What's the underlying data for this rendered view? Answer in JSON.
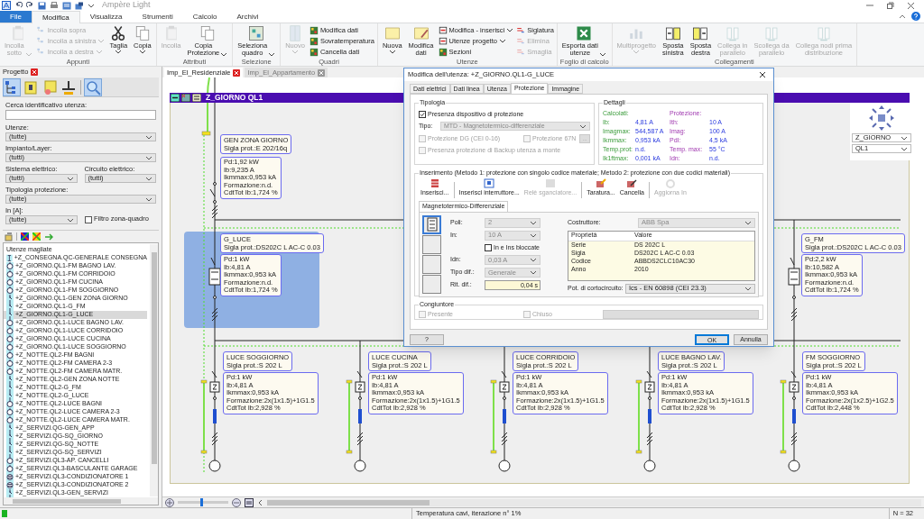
{
  "app": {
    "title": "Ampère Light"
  },
  "menu_tabs": [
    {
      "label": "File",
      "kind": "file",
      "selected": false
    },
    {
      "label": "Modifica",
      "kind": "tab",
      "selected": true
    },
    {
      "label": "Visualizza",
      "kind": "tab",
      "selected": false
    },
    {
      "label": "Strumenti",
      "kind": "tab",
      "selected": false
    },
    {
      "label": "Calcolo",
      "kind": "tab",
      "selected": false
    },
    {
      "label": "Archivi",
      "kind": "tab",
      "selected": false
    }
  ],
  "ribbon": [
    {
      "label": "Appunti",
      "items": [
        {
          "kind": "large",
          "label": "Incolla\nsotto",
          "disabled": true,
          "dropdown": true
        },
        {
          "kind": "stack",
          "buttons": [
            {
              "label": "Incolla sopra",
              "disabled": true,
              "dropdown": false
            },
            {
              "label": "Incolla a sinistra",
              "disabled": true,
              "dropdown": true
            },
            {
              "label": "Incolla a destra",
              "disabled": true,
              "dropdown": true
            }
          ]
        },
        {
          "kind": "large",
          "label": "Taglia",
          "disabled": false,
          "dropdown": true
        },
        {
          "kind": "large",
          "label": "Copia",
          "disabled": false,
          "dropdown": true
        }
      ]
    },
    {
      "label": "Attributi",
      "items": [
        {
          "kind": "large",
          "label": "Incolla",
          "disabled": true,
          "dropdown": false
        },
        {
          "kind": "large",
          "label": "Copia\nProtezione",
          "disabled": false,
          "dropdown": true
        }
      ]
    },
    {
      "label": "Selezione",
      "items": [
        {
          "kind": "large",
          "label": "Seleziona\nquadro",
          "disabled": false,
          "dropdown": true
        }
      ]
    },
    {
      "label": "Quadri",
      "items": [
        {
          "kind": "large",
          "label": "Nuovo",
          "disabled": true,
          "dropdown": true
        },
        {
          "kind": "stack",
          "buttons": [
            {
              "label": "Modifica dati",
              "disabled": false,
              "dropdown": false
            },
            {
              "label": "Sovratemperatura",
              "disabled": false,
              "dropdown": false
            },
            {
              "label": "Cancella dati",
              "disabled": false,
              "dropdown": false
            }
          ]
        }
      ]
    },
    {
      "label": "Utenze",
      "items": [
        {
          "kind": "large",
          "label": "Nuova",
          "disabled": false,
          "dropdown": true
        },
        {
          "kind": "large",
          "label": "Modifica\ndati",
          "disabled": false,
          "dropdown": false
        },
        {
          "kind": "stack",
          "buttons": [
            {
              "label": "Modifica - inserisci",
              "disabled": false,
              "dropdown": true
            },
            {
              "label": "Utenze progetto",
              "disabled": false,
              "dropdown": true
            },
            {
              "label": "Sezioni",
              "disabled": false,
              "dropdown": false
            }
          ]
        },
        {
          "kind": "stack",
          "buttons": [
            {
              "label": "Siglatura",
              "disabled": false,
              "dropdown": false
            },
            {
              "label": "Elimina",
              "disabled": true,
              "dropdown": false
            },
            {
              "label": "Smaglia",
              "disabled": true,
              "dropdown": false
            }
          ]
        }
      ]
    },
    {
      "label": "Foglio di calcolo",
      "items": [
        {
          "kind": "large",
          "label": "Esporta dati\nutenze",
          "disabled": false,
          "dropdown": true
        }
      ]
    },
    {
      "label": "Collegamenti",
      "items": [
        {
          "kind": "large",
          "label": "Multiprogetto",
          "disabled": true,
          "dropdown": true
        },
        {
          "kind": "large",
          "label": "Sposta\nsinistra",
          "disabled": false,
          "dropdown": false
        },
        {
          "kind": "large",
          "label": "Sposta\ndestra",
          "disabled": false,
          "dropdown": false
        },
        {
          "kind": "large",
          "label": "Collega in\nparallelo",
          "disabled": true,
          "dropdown": false
        },
        {
          "kind": "large",
          "label": "Scollega da\nparallelo",
          "disabled": true,
          "dropdown": false
        },
        {
          "kind": "large",
          "label": "Collega nodi prima\ndistribuzione",
          "disabled": true,
          "dropdown": false
        }
      ]
    }
  ],
  "project_panel": {
    "title": "Progetto",
    "toolbar": [
      {
        "selected": true
      },
      {
        "selected": false
      },
      {
        "selected": false
      },
      {
        "selected": false
      },
      {
        "selected": true
      }
    ],
    "search": {
      "label": "Cerca identificativo utenza:"
    },
    "filter_rows": [
      [
        {
          "label": "Utenze:",
          "value": "(tutte)"
        }
      ],
      [
        {
          "label": "Impianto/Layer:",
          "value": "(tutti)"
        }
      ],
      [
        {
          "label": "Sistema elettrico:",
          "value": "(tutti)"
        },
        {
          "label": "Circuito elettrico:",
          "value": "(tutti)"
        }
      ],
      [
        {
          "label": "Tipologia protezione:",
          "value": "(tutte)"
        }
      ],
      [
        {
          "label": "In [A]:",
          "value": "(tutte)"
        }
      ]
    ],
    "zone_filter": {
      "label": "Filtro zona-quadro",
      "checked": false
    },
    "list_title": "Utenze magliate",
    "items": [
      {
        "label": "+Z_CONSEGNA.QC-GENERALE CONSEGNA",
        "kind": "supply",
        "selected": false
      },
      {
        "label": "+Z_GIORNO.QL1-FM BAGNO LAV.",
        "kind": "load",
        "selected": false
      },
      {
        "label": "+Z_GIORNO.QL1-FM CORRIDOIO",
        "kind": "load",
        "selected": false
      },
      {
        "label": "+Z_GIORNO.QL1-FM CUCINA",
        "kind": "load",
        "selected": false
      },
      {
        "label": "+Z_GIORNO.QL1-FM SOGGIORNO",
        "kind": "load",
        "selected": false
      },
      {
        "label": "+Z_GIORNO.QL1-GEN ZONA GIORNO",
        "kind": "node",
        "selected": false
      },
      {
        "label": "+Z_GIORNO.QL1-G_FM",
        "kind": "node",
        "selected": false
      },
      {
        "label": "+Z_GIORNO.QL1-G_LUCE",
        "kind": "node",
        "selected": true
      },
      {
        "label": "+Z_GIORNO.QL1-LUCE BAGNO LAV.",
        "kind": "load",
        "selected": false
      },
      {
        "label": "+Z_GIORNO.QL1-LUCE CORRIDOIO",
        "kind": "load",
        "selected": false
      },
      {
        "label": "+Z_GIORNO.QL1-LUCE CUCINA",
        "kind": "load",
        "selected": false
      },
      {
        "label": "+Z_GIORNO.QL1-LUCE SOGGIORNO",
        "kind": "load",
        "selected": false
      },
      {
        "label": "+Z_NOTTE.QL2-FM BAGNI",
        "kind": "load",
        "selected": false
      },
      {
        "label": "+Z_NOTTE.QL2-FM CAMERA 2-3",
        "kind": "load",
        "selected": false
      },
      {
        "label": "+Z_NOTTE.QL2-FM CAMERA MATR.",
        "kind": "load",
        "selected": false
      },
      {
        "label": "+Z_NOTTE.QL2-GEN ZONA NOTTE",
        "kind": "node",
        "selected": false
      },
      {
        "label": "+Z_NOTTE.QL2-G_FM",
        "kind": "node",
        "selected": false
      },
      {
        "label": "+Z_NOTTE.QL2-G_LUCE",
        "kind": "node",
        "selected": false
      },
      {
        "label": "+Z_NOTTE.QL2-LUCE BAGNI",
        "kind": "load",
        "selected": false
      },
      {
        "label": "+Z_NOTTE.QL2-LUCE CAMERA 2-3",
        "kind": "load",
        "selected": false
      },
      {
        "label": "+Z_NOTTE.QL2-LUCE CAMERA MATR.",
        "kind": "load",
        "selected": false
      },
      {
        "label": "+Z_SERVIZI.QG-GEN_APP",
        "kind": "node",
        "selected": false
      },
      {
        "label": "+Z_SERVIZI.QG-SQ_GIORNO",
        "kind": "node",
        "selected": false
      },
      {
        "label": "+Z_SERVIZI.QG-SQ_NOTTE",
        "kind": "node",
        "selected": false
      },
      {
        "label": "+Z_SERVIZI.QG-SQ_SERVIZI",
        "kind": "node",
        "selected": false
      },
      {
        "label": "+Z_SERVIZI.QL3-AP. CANCELLI",
        "kind": "load",
        "selected": false
      },
      {
        "label": "+Z_SERVIZI.QL3-BASCULANTE GARAGE",
        "kind": "load",
        "selected": false
      },
      {
        "label": "+Z_SERVIZI.QL3-CONDIZIONATORE 1",
        "kind": "motor",
        "selected": false
      },
      {
        "label": "+Z_SERVIZI.QL3-CONDIZIONATORE 2",
        "kind": "motor",
        "selected": false
      },
      {
        "label": "+Z_SERVIZI.QL3-GEN_SERVIZI",
        "kind": "node",
        "selected": false
      }
    ]
  },
  "document_tabs": [
    {
      "label": "Imp_El_Residenziale",
      "selected": true
    },
    {
      "label": "Imp_El_Appartamento",
      "selected": false
    }
  ],
  "diagram": {
    "title": "Z_GIORNO QL1",
    "main_node": {
      "label": "GEN ZONA GIORNO",
      "sigla": "Sigla prot.:E 202/16q",
      "data": [
        "Pd:1,92 kW",
        "Ib:9,235 A",
        "Ikmmax:0,953 kA",
        "Formazione:n.d.",
        "CdtTot Ib:1,724 %"
      ]
    },
    "group_nodes": [
      {
        "label": "G_LUCE",
        "sigla": "Sigla prot.:DS202C L AC-C 0.03",
        "selected": true,
        "data": [
          "Pd:1 kW",
          "Ib:4,81 A",
          "Ikmmax:0,953 kA",
          "Formazione:n.d.",
          "CdtTot Ib:1,724 %"
        ]
      },
      {
        "label": "G_FM",
        "sigla": "Sigla prot.:DS202C L AC-C 0.03",
        "selected": false,
        "data": [
          "Pd:2,2 kW",
          "Ib:10,582 A",
          "Ikmmax:0,953 kA",
          "Formazione:n.d.",
          "CdtTot Ib:1,724 %"
        ]
      }
    ],
    "loads": [
      {
        "label": "LUCE SOGGIORNO",
        "sigla": "Sigla prot.:S 202 L",
        "data": [
          "Pd:1 kW",
          "Ib:4,81 A",
          "Ikmmax:0,953 kA",
          "Formazione:2x(1x1.5)+1G1.5",
          "CdtTot Ib:2,928 %"
        ]
      },
      {
        "label": "LUCE CUCINA",
        "sigla": "Sigla prot.:S 202 L",
        "data": [
          "Pd:1 kW",
          "Ib:4,81 A",
          "Ikmmax:0,953 kA",
          "Formazione:2x(1x1.5)+1G1.5",
          "CdtTot Ib:2,928 %"
        ]
      },
      {
        "label": "LUCE CORRIDOIO",
        "sigla": "Sigla prot.:S 202 L",
        "data": [
          "Pd:1 kW",
          "Ib:4,81 A",
          "Ikmmax:0,953 kA",
          "Formazione:2x(1x1.5)+1G1.5",
          "CdtTot Ib:2,928 %"
        ]
      },
      {
        "label": "LUCE BAGNO LAV.",
        "sigla": "Sigla prot.:S 202 L",
        "data": [
          "Pd:1 kW",
          "Ib:4,81 A",
          "Ikmmax:0,953 kA",
          "Formazione:2x(1x1.5)+1G1.5",
          "CdtTot Ib:2,928 %"
        ]
      },
      {
        "label": "FM SOGGIORNO",
        "sigla": "Sigla prot.:S 202 L",
        "data": [
          "Pd:1 kW",
          "Ib:4,81 A",
          "Ikmmax:0,953 kA",
          "Formazione:2x(1x2.5)+1G2.5",
          "CdtTot Ib:2,448 %"
        ]
      }
    ],
    "navigator": {
      "zone": "Z_GIORNO",
      "panel": "QL1"
    },
    "zoom": {
      "level": 0.45
    }
  },
  "dialog": {
    "title": "Modifica dell'utenza: +Z_GIORNO.QL1-G_LUCE",
    "tabs": [
      {
        "label": "Dati elettrici",
        "selected": false
      },
      {
        "label": "Dati linea",
        "selected": false
      },
      {
        "label": "Utenza",
        "selected": false
      },
      {
        "label": "Protezione",
        "selected": true
      },
      {
        "label": "Immagine",
        "selected": false
      }
    ],
    "tipologia": {
      "title": "Tipologia",
      "presence": {
        "label": "Presenza dispositivo di protezione",
        "checked": true,
        "disabled": false
      },
      "tipo_label": "Tipo:",
      "tipo_value": "MTD - Magnetotermico-differenziale",
      "dg": {
        "label": "Protezione DG (CEI 0-16)",
        "checked": false,
        "disabled": true
      },
      "p67n": {
        "label": "Protezione 67N",
        "checked": false,
        "disabled": true
      },
      "more_button": "...",
      "backup": {
        "label": "Presenza protezione di Backup utenza a monte",
        "checked": false,
        "disabled": true
      }
    },
    "dettagli": {
      "title": "Dettagli",
      "calc_title": "Calcolati:",
      "prot_title": "Protezione:",
      "rows": [
        {
          "calc_label": "Ib:",
          "calc_value": "4,81 A",
          "prot_label": "Ith:",
          "prot_value": "10 A"
        },
        {
          "calc_label": "Imagmax:",
          "calc_value": "544,587 A",
          "prot_label": "Imag:",
          "prot_value": "100 A"
        },
        {
          "calc_label": "Ikmmax:",
          "calc_value": "0,953 kA",
          "prot_label": "PdI:",
          "prot_value": "4,5 kA"
        },
        {
          "calc_label": "Temp.prot:",
          "calc_value": "n.d.",
          "prot_label": "Temp. max:",
          "prot_value": "55 °C"
        },
        {
          "calc_label": "Ik1ftmax:",
          "calc_value": "0,001 kA",
          "prot_label": "Idn:",
          "prot_value": "n.d."
        }
      ]
    },
    "inserimento": {
      "title": "Inserimento (Metodo 1: protezione con singolo codice materiale; Metodo 2: protezione con due codici materiali)",
      "tools": [
        {
          "label": "Inserisci...",
          "disabled": false
        },
        {
          "label": "Inserisci interruttore...",
          "disabled": false
        },
        {
          "label": "Relè sganciatore...",
          "disabled": true
        },
        {
          "label": "Taratura...",
          "disabled": false
        },
        {
          "label": "Cancella",
          "disabled": false
        },
        {
          "label": "Aggiorna In",
          "disabled": true
        }
      ],
      "subtab": "Magnetotermico-Differenziale",
      "slots": [
        {
          "selected": true,
          "filled": true
        },
        {
          "selected": false,
          "filled": false
        },
        {
          "selected": false,
          "filled": false
        },
        {
          "selected": false,
          "filled": false
        }
      ],
      "fields": [
        {
          "label": "Poli:",
          "value": "2",
          "kind": "select"
        },
        {
          "label": "In:",
          "value": "10 A",
          "kind": "select"
        },
        {
          "label": "Idn:",
          "value": "0,03 A",
          "kind": "select"
        },
        {
          "label": "Tipo dif.:",
          "value": "Generale",
          "kind": "select"
        },
        {
          "label": "Rit. dif.:",
          "value": "0,04 s",
          "kind": "input"
        }
      ],
      "locked": {
        "label": "In e Ins bloccate",
        "checked": false
      },
      "manufacturer_label": "Costruttore:",
      "manufacturer": "ABB Spa",
      "table_columns": [
        "Proprietà",
        "Valore"
      ],
      "table_rows": [
        [
          "Serie",
          "DS 202C L"
        ],
        [
          "Sigla",
          "DS202C L AC-C 0.03"
        ],
        [
          "Codice",
          "ABBDS2CLC10AC30"
        ],
        [
          "Anno",
          "2010"
        ]
      ],
      "breaking_label": "Pot. di cortocircuito:",
      "breaking_value": "Ics - EN 60898 (CEI 23.3)"
    },
    "congiuntore": {
      "title": "Congiuntore",
      "present": {
        "label": "Presente",
        "checked": false,
        "disabled": true
      },
      "closed": {
        "label": "Chiuso",
        "checked": false,
        "disabled": true
      }
    },
    "buttons": [
      {
        "label": "?",
        "kind": "help"
      },
      {
        "label": "OK",
        "kind": "default"
      },
      {
        "label": "Annulla",
        "kind": "normal"
      }
    ]
  },
  "status_bar": {
    "message": "Temperatura cavi, iterazione n° 1%",
    "count": "N = 32"
  }
}
